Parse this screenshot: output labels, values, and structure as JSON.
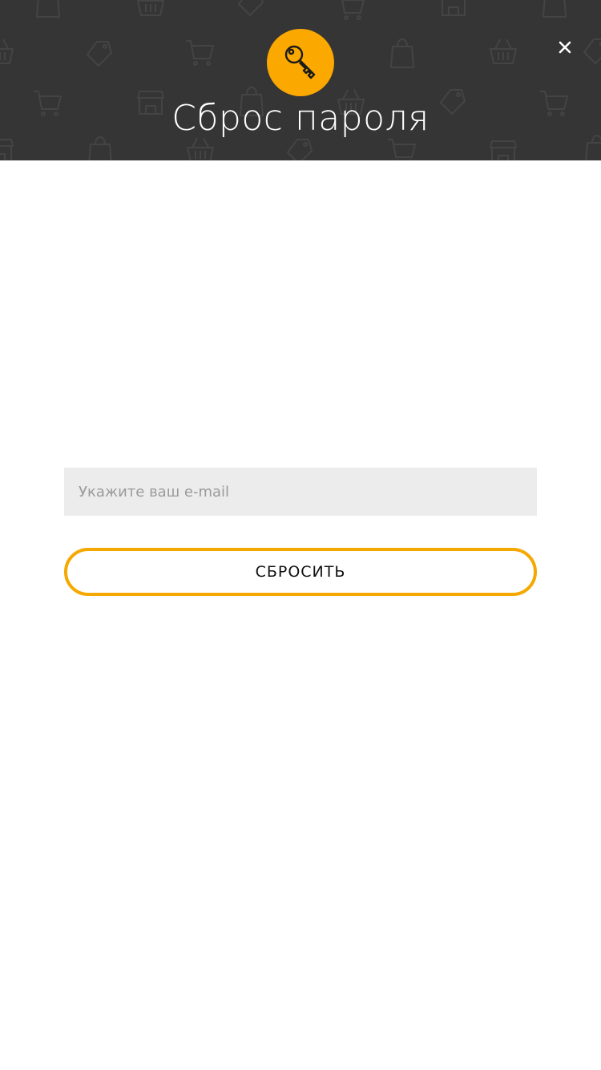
{
  "header": {
    "title": "Сброс пароля",
    "icon": "key-icon",
    "background_pattern_icons": [
      "shopping-bag-icon",
      "basket-icon",
      "price-tag-icon",
      "shopping-cart-icon",
      "storefront-icon"
    ],
    "close_icon": "close-icon"
  },
  "form": {
    "email": {
      "value": "",
      "placeholder": "Укажите ваш e-mail"
    },
    "submit_label": "СБРОСИТЬ"
  },
  "colors": {
    "header_bg": "#353535",
    "accent": "#fba800",
    "input_bg": "#ececec",
    "title_text": "#ffffff"
  }
}
